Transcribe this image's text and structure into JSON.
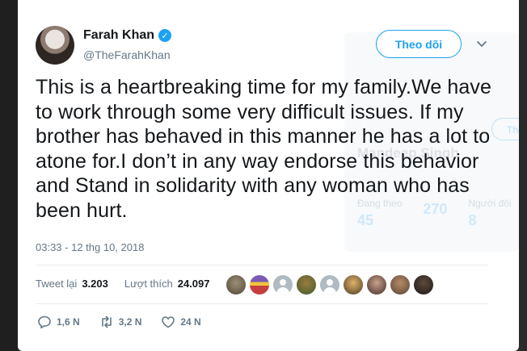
{
  "tweet": {
    "author": {
      "name": "Farah Khan",
      "handle": "@TheFarahKhan",
      "verified_glyph": "✓"
    },
    "follow_label": "Theo dõi",
    "caret_glyph": "⌄",
    "text": "This is a heartbreaking time for my family.We have to work through some very difficult issues. If my brother has behaved in this manner he has a lot to atone for.I don’t in any way endorse this behavior and Stand in solidarity with any woman who has been hurt.",
    "timestamp": "03:33 - 12 thg 10, 2018",
    "stats": {
      "retweets_label": "Tweet lại",
      "retweets_value": "3.203",
      "likes_label": "Lượt thích",
      "likes_value": "24.097"
    },
    "actions": {
      "replies": "1,6 N",
      "retweets": "3,2 N",
      "likes": "24 N"
    }
  },
  "background_card": {
    "name": "Mandeep Singh",
    "button_label": "The",
    "stats": [
      {
        "label": "Đang theo",
        "value": "45"
      },
      {
        "label": "",
        "value": "270"
      },
      {
        "label": "Người đôi",
        "value": "8"
      }
    ]
  },
  "colors": {
    "accent": "#1da1f2",
    "text": "#14171a",
    "muted": "#657786"
  }
}
